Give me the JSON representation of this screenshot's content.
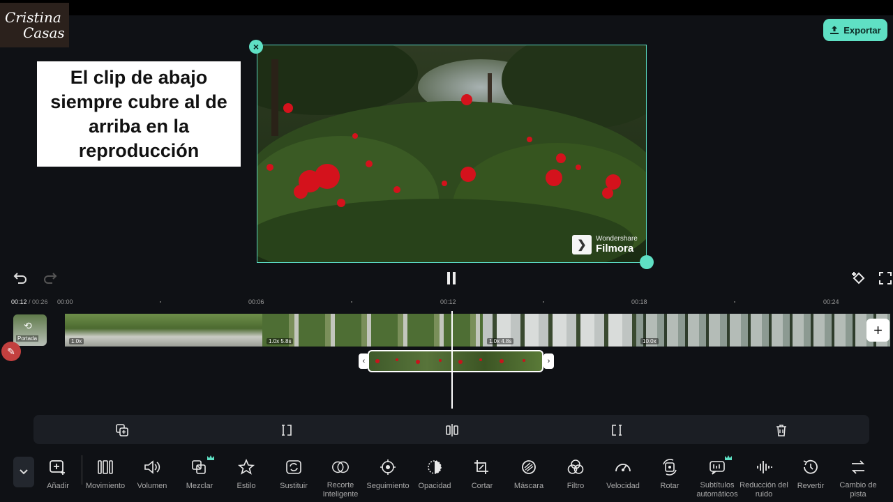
{
  "watermark": {
    "line1": "Cristina",
    "line2": "Casas"
  },
  "export_label": "Exportar",
  "callout_text": "El clip de abajo siempre cubre al de arriba en la reproducción",
  "preview": {
    "brand_top": "Wondershare",
    "brand_bottom": "Filmora"
  },
  "time": {
    "current": "00:12",
    "total": " / 00:26"
  },
  "ruler": [
    "00:00",
    "00:06",
    "00:12",
    "00:18",
    "00:24"
  ],
  "cover_label": "Portada",
  "tracks": [
    {
      "badge": "1.0x",
      "duration": ""
    },
    {
      "badge": "1.0x",
      "duration": "5.8s"
    },
    {
      "badge": "1.0x",
      "duration": "4.8s"
    },
    {
      "badge": "10.0x",
      "duration": ""
    }
  ],
  "colors": {
    "accent": "#5fe0c4",
    "background": "#0f1115",
    "toolbar": "#1b1e24"
  },
  "tools": [
    {
      "label": "Añadir",
      "icon": "add-media-icon"
    },
    {
      "label": "Movimiento",
      "icon": "motion-icon"
    },
    {
      "label": "Volumen",
      "icon": "volume-icon"
    },
    {
      "label": "Mezclar",
      "icon": "blend-icon",
      "premium": true
    },
    {
      "label": "Estilo",
      "icon": "style-icon"
    },
    {
      "label": "Sustituir",
      "icon": "replace-icon"
    },
    {
      "label": "Recorte Inteligente",
      "icon": "smart-cutout-icon"
    },
    {
      "label": "Seguimiento",
      "icon": "tracking-icon"
    },
    {
      "label": "Opacidad",
      "icon": "opacity-icon"
    },
    {
      "label": "Cortar",
      "icon": "crop-icon"
    },
    {
      "label": "Máscara",
      "icon": "mask-icon"
    },
    {
      "label": "Filtro",
      "icon": "filter-icon"
    },
    {
      "label": "Velocidad",
      "icon": "speed-icon"
    },
    {
      "label": "Rotar",
      "icon": "rotate-icon"
    },
    {
      "label": "Subtítulos automáticos",
      "icon": "auto-captions-icon",
      "premium": true
    },
    {
      "label": "Reducción del ruido",
      "icon": "denoise-icon"
    },
    {
      "label": "Revertir",
      "icon": "reverse-icon"
    },
    {
      "label": "Cambio de pista",
      "icon": "switch-track-icon"
    }
  ]
}
